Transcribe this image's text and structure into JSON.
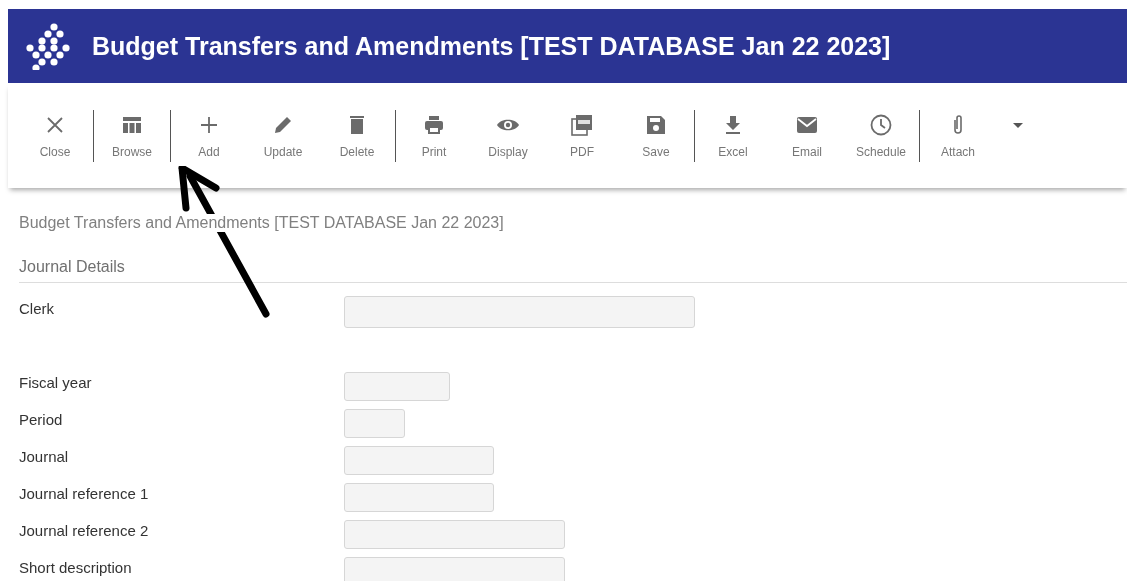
{
  "window": {
    "title": "Budget Transfers and Amendments [TEST DATABASE Jan 22 2023]"
  },
  "toolbar": {
    "groups": [
      [
        {
          "label": "Close"
        }
      ],
      [
        {
          "label": "Browse"
        }
      ],
      [
        {
          "label": "Add"
        },
        {
          "label": "Update"
        },
        {
          "label": "Delete"
        }
      ],
      [
        {
          "label": "Print"
        },
        {
          "label": "Display"
        },
        {
          "label": "PDF"
        },
        {
          "label": "Save"
        }
      ],
      [
        {
          "label": "Excel"
        },
        {
          "label": "Email"
        },
        {
          "label": "Schedule"
        }
      ],
      [
        {
          "label": "Attach"
        }
      ]
    ]
  },
  "page_title": "Budget Transfers and Amendments [TEST DATABASE Jan 22 2023]",
  "section": {
    "title": "Journal Details"
  },
  "fields": [
    {
      "label": "Clerk",
      "kind": "xl"
    },
    {
      "label": "Fiscal year",
      "kind": "m"
    },
    {
      "label": "Period",
      "kind": "s"
    },
    {
      "label": "Journal",
      "kind": "l"
    },
    {
      "label": "Journal reference 1",
      "kind": "l"
    },
    {
      "label": "Journal reference 2",
      "kind": "xw"
    },
    {
      "label": "Short description",
      "kind": "xw"
    }
  ],
  "annotation": {
    "kind": "arrow"
  }
}
